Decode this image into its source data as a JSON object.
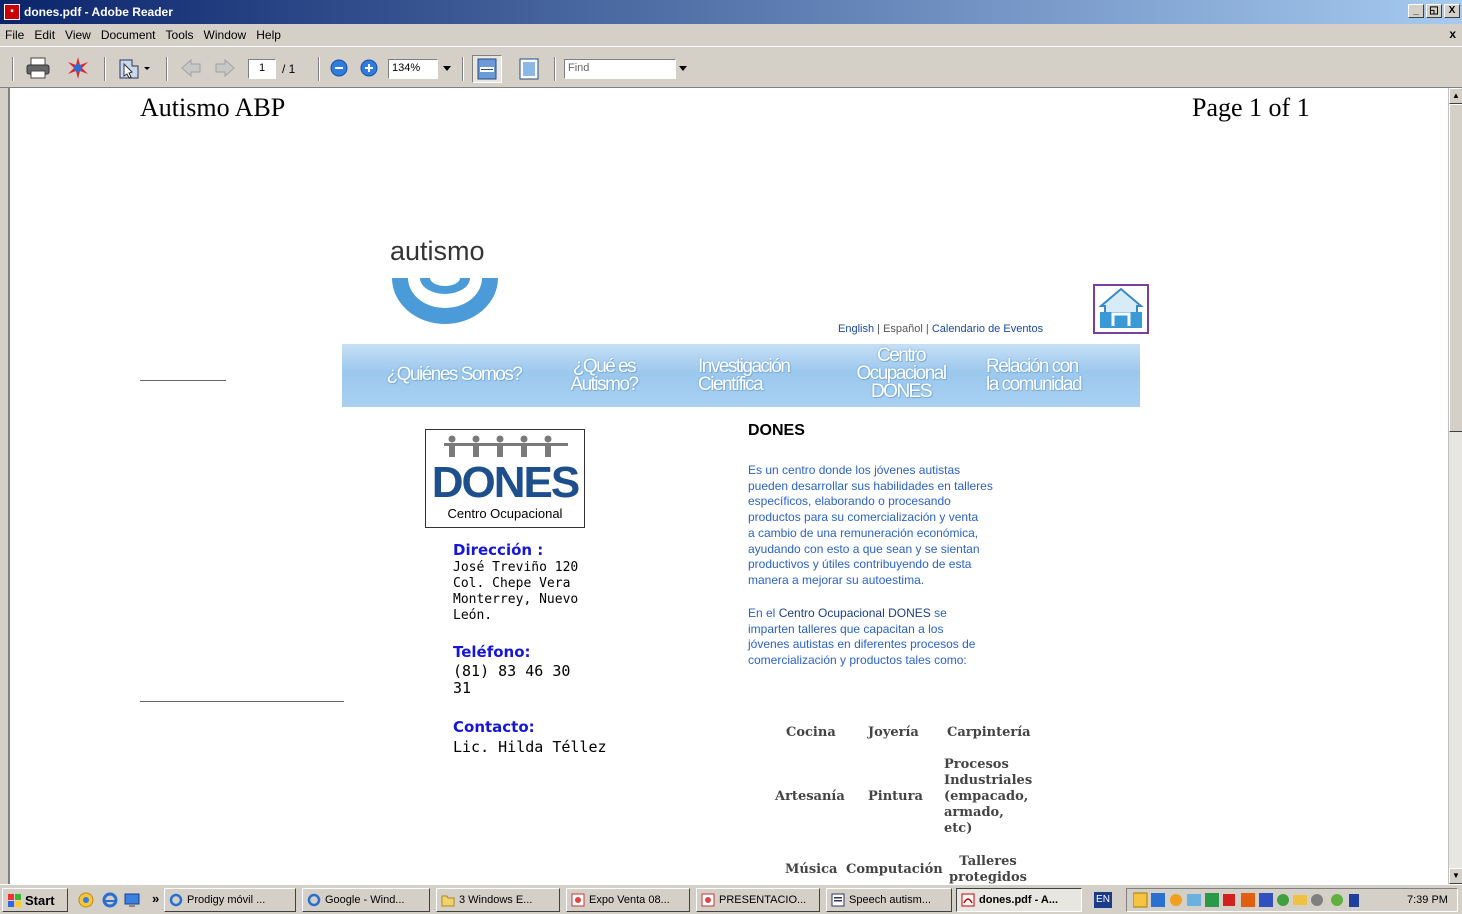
{
  "window": {
    "title": "dones.pdf - Adobe Reader",
    "min_label": "_",
    "max_label": "&#x25A1;",
    "close_label": "X"
  },
  "menu": {
    "items": [
      "File",
      "Edit",
      "View",
      "Document",
      "Tools",
      "Window",
      "Help"
    ],
    "close_label": "x"
  },
  "toolbar": {
    "page_input": "1",
    "page_total": "/ 1",
    "zoom": "134%",
    "find_placeholder": "Find"
  },
  "page": {
    "header_left": "Autismo ABP",
    "header_right": "Page 1 of 1",
    "logo_text": "autismo",
    "lang_links": {
      "english": "English",
      "sep1": " | ",
      "espanol": "Español",
      "sep2": " | ",
      "calendario": "Calendario de Eventos"
    },
    "nav": [
      "¿Quiénes Somos?",
      "¿Qué es\nAutismo?",
      "Investigación\nCientífica",
      "Centro\nOcupacional\nDONES",
      "Relación con\nla comunidad"
    ],
    "dones_logo": {
      "word": "DONES",
      "sub": "Centro Ocupacional"
    },
    "contact": {
      "dir_label": "Dirección :",
      "dir_lines": [
        "José Treviño 120",
        "Col. Chepe Vera",
        "Monterrey, Nuevo",
        "León."
      ],
      "tel_label": "Teléfono:",
      "tel_lines": [
        "(81) 83 46 30",
        "31"
      ],
      "contact_label": "Contacto:",
      "contact_name": "Lic. Hilda Téllez"
    },
    "section_title": "DONES",
    "para1": [
      "Es un centro donde los jóvenes autistas",
      "pueden desarrollar sus habilidades en talleres",
      "específicos, elaborando o procesando",
      "productos para su comercialización y venta",
      "a cambio de una remuneración económica,",
      "ayudando con esto a que sean y se sientan",
      "productivos y útiles contribuyendo de esta",
      "manera a mejorar su autoestima."
    ],
    "para2": {
      "pre": "En el ",
      "bold": "Centro Ocupacional DONES",
      "post": " se",
      "rest": [
        "imparten talleres que capacitan a los",
        "jóvenes autistas en diferentes procesos de",
        "comercialización y productos tales como:"
      ]
    },
    "workshops": [
      [
        "Cocina",
        "Joyería",
        "Carpintería"
      ],
      [
        "Artesanía",
        "Pintura",
        "Procesos\nIndustriales\n(empacado,\narmado,\netc)"
      ],
      [
        "Música",
        "Computación",
        "Talleres\nprotegidos"
      ]
    ]
  },
  "taskbar": {
    "start": "start",
    "chevron": "»",
    "buttons": [
      "Prodigy móvil ...",
      "Google - Wind...",
      "3 Windows E...",
      "Expo Venta 08...",
      "PRESENTACIO...",
      "Speech autism...",
      "dones.pdf - A..."
    ],
    "lang": "EN",
    "clock": "7:39 PM"
  },
  "colors": {
    "accent_blue": "#1616d8",
    "para_blue": "#2a62c8",
    "nav_blue": "#9cc8ee",
    "logo_blue": "#4a9bd8"
  }
}
